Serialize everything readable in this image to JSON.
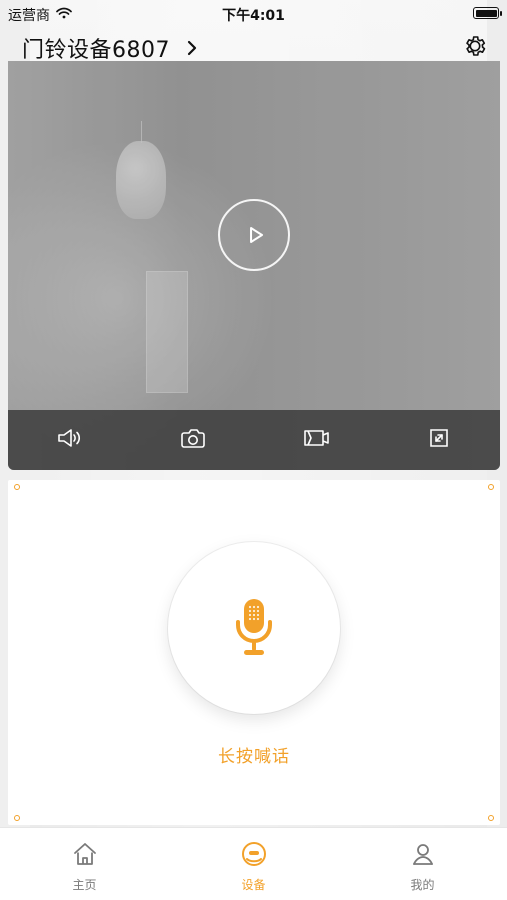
{
  "status_bar": {
    "carrier": "运营商",
    "time": "下午4:01"
  },
  "header": {
    "title": "门铃设备6807"
  },
  "video": {
    "icons": {
      "play": "play-icon",
      "toolbar": [
        "speaker-icon",
        "camera-icon",
        "video-record-icon",
        "fullscreen-icon"
      ]
    }
  },
  "voice": {
    "label": "长按喊话",
    "icon": "microphone-icon"
  },
  "tabbar": {
    "items": [
      {
        "label": "主页",
        "icon": "home-icon"
      },
      {
        "label": "设备",
        "icon": "device-icon"
      },
      {
        "label": "我的",
        "icon": "user-icon"
      }
    ]
  },
  "colors": {
    "accent": "#f2a12a",
    "toolbar_bg": "#3c3c3c",
    "tab_inactive": "#7a7a7a"
  }
}
